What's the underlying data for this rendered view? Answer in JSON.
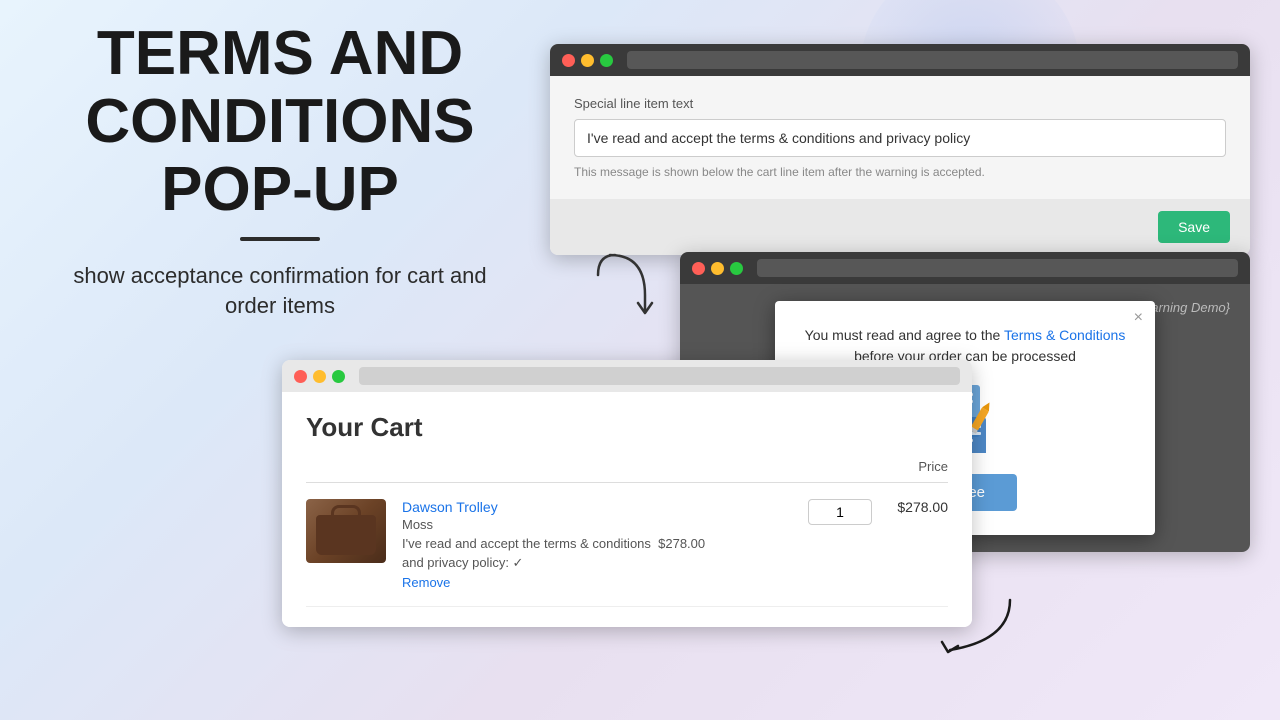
{
  "background": {
    "gradient": "linear-gradient(135deg, #e8f4fd, #dce8f8, #e8e0f0)"
  },
  "title": {
    "line1": "TERMS AND",
    "line2": "CONDITIONS",
    "line3": "POP-UP"
  },
  "subtitle": "show acceptance confirmation for cart and order items",
  "settings_window": {
    "address_bar_placeholder": "",
    "label": "Special line item text",
    "input_value": "I've read and accept the terms & conditions and privacy policy",
    "hint": "This message is shown below the cart line item after the warning is accepted.",
    "save_button": "Save"
  },
  "popup_window": {
    "demo_label": "{Terms&Conditions Warning Demo}",
    "modal": {
      "message_before": "You must read and agree to the ",
      "link_text": "Terms & Conditions",
      "message_after": " before your order can be processed",
      "close_button": "×",
      "agree_button": "Agree"
    }
  },
  "cart_window": {
    "title": "Your Cart",
    "table_header": "Price",
    "product": {
      "name": "Dawson Trolley",
      "variant": "Moss",
      "note": "I've read and accept the terms & conditions",
      "note2": "and privacy policy: ✓",
      "price": "$278.00",
      "quantity": "1",
      "line_price": "$278.00",
      "remove_link": "Remove"
    }
  }
}
